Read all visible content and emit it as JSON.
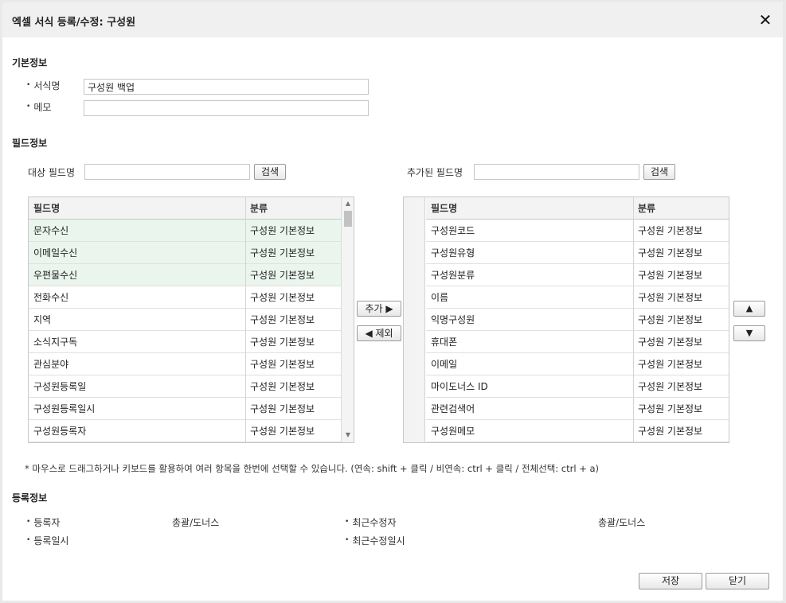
{
  "dialog": {
    "title": "엑셀 서식 등록/수정: 구성원",
    "close_icon": "✕"
  },
  "basic": {
    "section_title": "기본정보",
    "name_label": "서식명",
    "name_value": "구성원 백업",
    "memo_label": "메모",
    "memo_value": ""
  },
  "fields": {
    "section_title": "필드정보",
    "target_label": "대상 필드명",
    "target_search_value": "",
    "target_search_button": "검색",
    "added_label": "추가된 필드명",
    "added_search_value": "",
    "added_search_button": "검색",
    "left_grid": {
      "headers": [
        "필드명",
        "분류"
      ],
      "rows": [
        {
          "name": "문자수신",
          "category": "구성원 기본정보",
          "selected": true
        },
        {
          "name": "이메일수신",
          "category": "구성원 기본정보",
          "selected": true
        },
        {
          "name": "우편물수신",
          "category": "구성원 기본정보",
          "selected": true
        },
        {
          "name": "전화수신",
          "category": "구성원 기본정보",
          "selected": false
        },
        {
          "name": "지역",
          "category": "구성원 기본정보",
          "selected": false
        },
        {
          "name": "소식지구독",
          "category": "구성원 기본정보",
          "selected": false
        },
        {
          "name": "관심분야",
          "category": "구성원 기본정보",
          "selected": false
        },
        {
          "name": "구성원등록일",
          "category": "구성원 기본정보",
          "selected": false
        },
        {
          "name": "구성원등록일시",
          "category": "구성원 기본정보",
          "selected": false
        },
        {
          "name": "구성원등록자",
          "category": "구성원 기본정보",
          "selected": false
        }
      ]
    },
    "right_grid": {
      "headers": [
        "필드명",
        "분류"
      ],
      "rows": [
        {
          "name": "구성원코드",
          "category": "구성원 기본정보"
        },
        {
          "name": "구성원유형",
          "category": "구성원 기본정보"
        },
        {
          "name": "구성원분류",
          "category": "구성원 기본정보"
        },
        {
          "name": "이름",
          "category": "구성원 기본정보"
        },
        {
          "name": "익명구성원",
          "category": "구성원 기본정보"
        },
        {
          "name": "휴대폰",
          "category": "구성원 기본정보"
        },
        {
          "name": "이메일",
          "category": "구성원 기본정보"
        },
        {
          "name": "마이도너스 ID",
          "category": "구성원 기본정보"
        },
        {
          "name": "관련검색어",
          "category": "구성원 기본정보"
        },
        {
          "name": "구성원메모",
          "category": "구성원 기본정보"
        }
      ]
    },
    "add_button": "추가 ▶",
    "remove_button": "◀ 제외",
    "move_up_icon": "▲",
    "move_down_icon": "▼",
    "note": "* 마우스로 드래그하거나 키보드를 활용하여 여러 항목을 한번에 선택할 수 있습니다. (연속: shift + 클릭 / 비연속: ctrl + 클릭 / 전체선택: ctrl + a)"
  },
  "registration": {
    "section_title": "등록정보",
    "registrant_label": "등록자",
    "registrant_value": "총괄/도너스",
    "registered_at_label": "등록일시",
    "registered_at_value": "",
    "last_modifier_label": "최근수정자",
    "last_modifier_value": "총괄/도너스",
    "last_modified_at_label": "최근수정일시",
    "last_modified_at_value": ""
  },
  "footer": {
    "save_button": "저장",
    "close_button": "닫기"
  }
}
